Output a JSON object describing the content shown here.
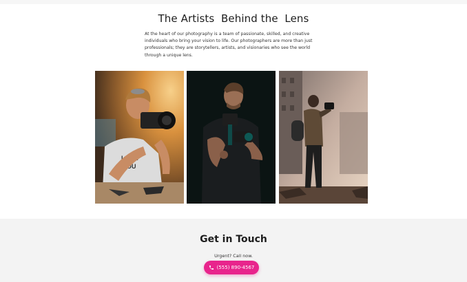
{
  "artists": {
    "title": "The Artists  Behind the  Lens",
    "description": "At the heart of our photography is a team of passionate, skilled, and creative individuals who bring your vision to life. Our photographers are more than just professionals; they are storytellers, artists, and visionaries who see the world through a unique lens.",
    "photos": [
      {
        "subject": "woman-with-camera-sunset",
        "icon": "photo-icon"
      },
      {
        "subject": "man-with-camera-dark",
        "icon": "photo-icon"
      },
      {
        "subject": "man-with-camera-backpack-city",
        "icon": "photo-icon"
      }
    ]
  },
  "contact": {
    "title": "Get in Touch",
    "urgent_text": "Urgent? Call now.",
    "call_button_label": "(555) 890-4567",
    "call_icon": "phone-icon",
    "accent_color": "#e8248c"
  }
}
